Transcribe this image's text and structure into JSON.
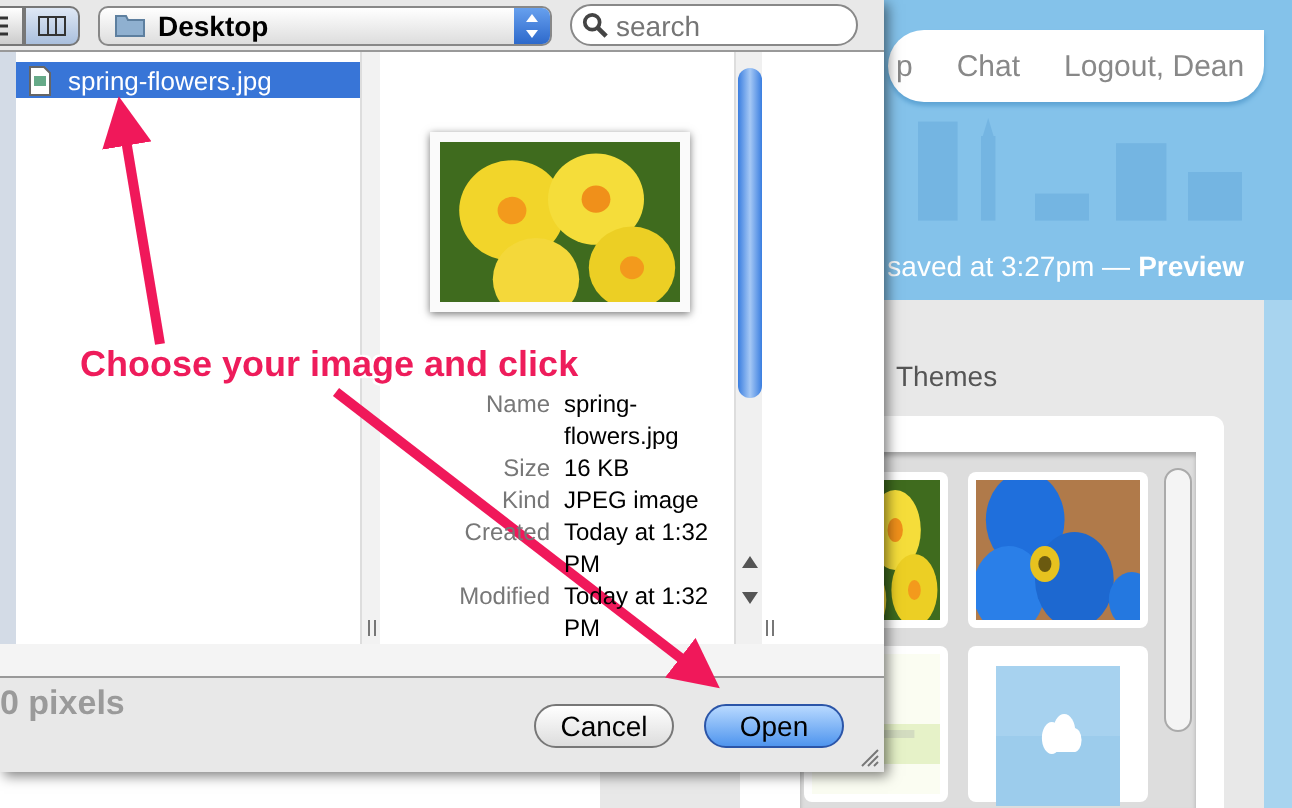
{
  "page": {
    "nav": [
      "p",
      "Chat",
      "Logout, Dean"
    ],
    "status": "saved at 3:27pm —",
    "status_link": "Preview",
    "panel": {
      "tab": "Themes"
    },
    "dimension_text": "0 pixels"
  },
  "dialog": {
    "view_modes": [
      {
        "kind": "list",
        "selected": false
      },
      {
        "kind": "columns",
        "selected": true
      }
    ],
    "location": "Desktop",
    "search": {
      "placeholder": "search"
    },
    "files": [
      {
        "name": "spring-flowers.jpg",
        "selected": true
      }
    ],
    "preview": {
      "kind": "picture",
      "info": [
        {
          "label": "Name",
          "value": "spring-flowers.jpg"
        },
        {
          "label": "Size",
          "value": "16 KB"
        },
        {
          "label": "Kind",
          "value": "JPEG image"
        },
        {
          "label": "Created",
          "value": "Today at 1:32 PM"
        },
        {
          "label": "Modified",
          "value": "Today at 1:32 PM"
        }
      ]
    },
    "buttons": [
      {
        "label": "Cancel",
        "kind": "cancel"
      },
      {
        "label": "Open",
        "kind": "default"
      }
    ]
  },
  "annotation": {
    "text": "Choose your image and click"
  }
}
